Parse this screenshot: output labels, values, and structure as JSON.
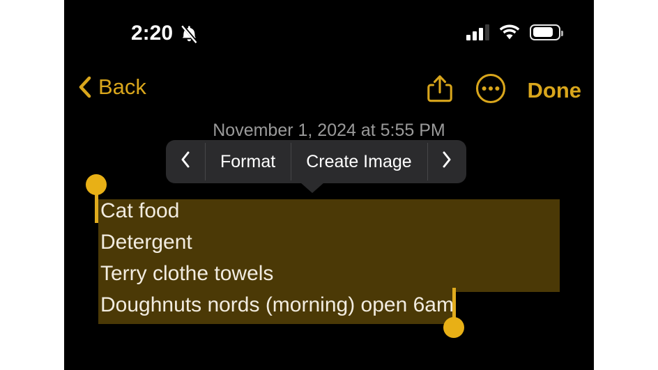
{
  "status_bar": {
    "time": "2:20",
    "silent_icon": "bell-slash-icon",
    "signal_icon": "cellular-signal-icon",
    "wifi_icon": "wifi-icon",
    "battery_icon": "battery-icon"
  },
  "nav_bar": {
    "back_label": "Back",
    "back_icon": "chevron-left-icon",
    "share_icon": "share-icon",
    "more_icon": "ellipsis-circle-icon",
    "done_label": "Done"
  },
  "note": {
    "date": "November 1, 2024 at 5:55 PM",
    "lines": [
      "Cat food",
      "Detergent",
      "Terry clothe towels",
      "Doughnuts nords (morning) open 6am"
    ]
  },
  "context_menu": {
    "prev_label": "‹",
    "prev_icon": "chevron-left-icon",
    "items": [
      {
        "label": "Format"
      },
      {
        "label": "Create Image"
      }
    ],
    "next_label": "›",
    "next_icon": "chevron-right-icon"
  },
  "colors": {
    "accent": "#d9a61c",
    "selection_highlight": "#4b3906",
    "handle": "#e8b016",
    "screen_background": "#000000",
    "menu_background": "#2b2b2d",
    "note_text": "#f2ece0",
    "date_text": "#9a9a9a"
  }
}
